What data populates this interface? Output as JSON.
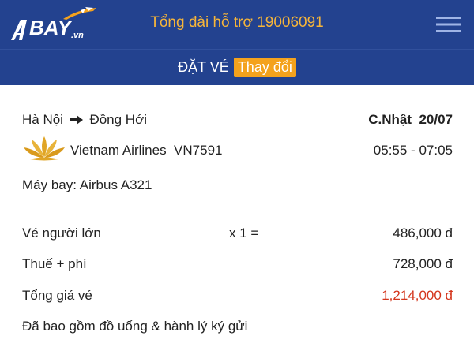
{
  "header": {
    "logo_text": "BAY",
    "logo_suffix": ".vn",
    "hotline": "Tổng đài hỗ trợ 19006091",
    "menu_icon": "hamburger-menu-icon"
  },
  "booking_bar": {
    "title": "ĐẶT VÉ",
    "change_label": "Thay đổi"
  },
  "flight": {
    "origin": "Hà Nội",
    "destination": "Đồng Hới",
    "date": "C.Nhật  20/07",
    "airline": "Vietnam Airlines",
    "flight_no": "VN7591",
    "airline_logo_icon": "vietnam-airlines-lotus-icon",
    "time": "05:55 - 07:05",
    "aircraft": "Máy bay: Airbus A321"
  },
  "fare": {
    "adult_label": "Vé người lớn",
    "adult_qty": "x 1 =",
    "adult_price": "486,000 đ",
    "tax_label": "Thuế + phí",
    "tax_price": "728,000 đ",
    "total_label": "Tổng giá vé",
    "total_price": "1,214,000 đ",
    "note": "Đã bao gồm đồ uống & hành lý ký gửi"
  },
  "colors": {
    "header_bg": "#23428f",
    "accent_orange": "#f4a21d",
    "hotline_text": "#f6b53a",
    "total_red": "#d4351c"
  }
}
